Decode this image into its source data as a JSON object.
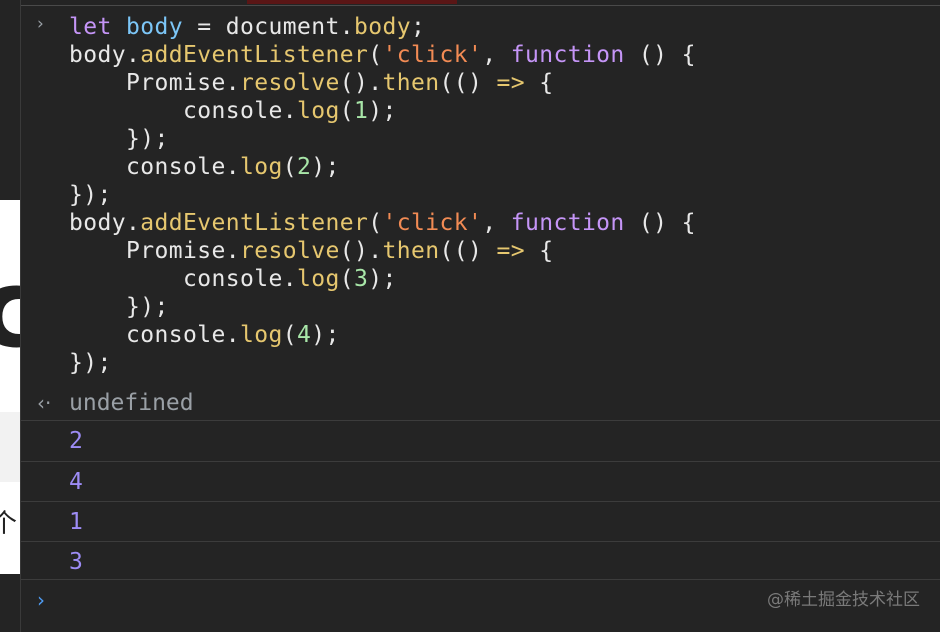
{
  "left_page": {
    "big_glyph": "c",
    "small_glyph": "个"
  },
  "console": {
    "input_prompt_glyph": "›",
    "result_prompt_glyph": "‹·",
    "code_lines": [
      [
        {
          "t": "let ",
          "c": "kw"
        },
        {
          "t": "body",
          "c": "var"
        },
        {
          "t": " = document.",
          "c": "txt"
        },
        {
          "t": "body",
          "c": "fn"
        },
        {
          "t": ";",
          "c": "txt"
        }
      ],
      [
        {
          "t": "body.",
          "c": "txt"
        },
        {
          "t": "addEventListener",
          "c": "fn"
        },
        {
          "t": "(",
          "c": "txt"
        },
        {
          "t": "'click'",
          "c": "str"
        },
        {
          "t": ", ",
          "c": "txt"
        },
        {
          "t": "function",
          "c": "kw"
        },
        {
          "t": " () {",
          "c": "txt"
        }
      ],
      [
        {
          "t": "    Promise.",
          "c": "txt"
        },
        {
          "t": "resolve",
          "c": "fn"
        },
        {
          "t": "().",
          "c": "txt"
        },
        {
          "t": "then",
          "c": "fn"
        },
        {
          "t": "(() ",
          "c": "txt"
        },
        {
          "t": "=>",
          "c": "fn"
        },
        {
          "t": " {",
          "c": "txt"
        }
      ],
      [
        {
          "t": "        console.",
          "c": "txt"
        },
        {
          "t": "log",
          "c": "fn"
        },
        {
          "t": "(",
          "c": "txt"
        },
        {
          "t": "1",
          "c": "num"
        },
        {
          "t": ");",
          "c": "txt"
        }
      ],
      [
        {
          "t": "    });",
          "c": "txt"
        }
      ],
      [
        {
          "t": "    console.",
          "c": "txt"
        },
        {
          "t": "log",
          "c": "fn"
        },
        {
          "t": "(",
          "c": "txt"
        },
        {
          "t": "2",
          "c": "num"
        },
        {
          "t": ");",
          "c": "txt"
        }
      ],
      [
        {
          "t": "});",
          "c": "txt"
        }
      ],
      [
        {
          "t": "body.",
          "c": "txt"
        },
        {
          "t": "addEventListener",
          "c": "fn"
        },
        {
          "t": "(",
          "c": "txt"
        },
        {
          "t": "'click'",
          "c": "str"
        },
        {
          "t": ", ",
          "c": "txt"
        },
        {
          "t": "function",
          "c": "kw"
        },
        {
          "t": " () {",
          "c": "txt"
        }
      ],
      [
        {
          "t": "    Promise.",
          "c": "txt"
        },
        {
          "t": "resolve",
          "c": "fn"
        },
        {
          "t": "().",
          "c": "txt"
        },
        {
          "t": "then",
          "c": "fn"
        },
        {
          "t": "(() ",
          "c": "txt"
        },
        {
          "t": "=>",
          "c": "fn"
        },
        {
          "t": " {",
          "c": "txt"
        }
      ],
      [
        {
          "t": "        console.",
          "c": "txt"
        },
        {
          "t": "log",
          "c": "fn"
        },
        {
          "t": "(",
          "c": "txt"
        },
        {
          "t": "3",
          "c": "num"
        },
        {
          "t": ");",
          "c": "txt"
        }
      ],
      [
        {
          "t": "    });",
          "c": "txt"
        }
      ],
      [
        {
          "t": "    console.",
          "c": "txt"
        },
        {
          "t": "log",
          "c": "fn"
        },
        {
          "t": "(",
          "c": "txt"
        },
        {
          "t": "4",
          "c": "num"
        },
        {
          "t": ");",
          "c": "txt"
        }
      ],
      [
        {
          "t": "});",
          "c": "txt"
        }
      ]
    ],
    "result": "undefined",
    "logs": [
      "2",
      "4",
      "1",
      "3"
    ],
    "bottom_prompt_glyph": "›"
  },
  "watermark": "@稀土掘金技术社区",
  "colors": {
    "background": "#242424",
    "keyword": "#c595f7",
    "variable": "#7cc6f7",
    "function": "#e6c76f",
    "string": "#f28b54",
    "number": "#a8e6a8",
    "log_value": "#9d8cf5",
    "prompt_accent": "#4f9cf3"
  }
}
